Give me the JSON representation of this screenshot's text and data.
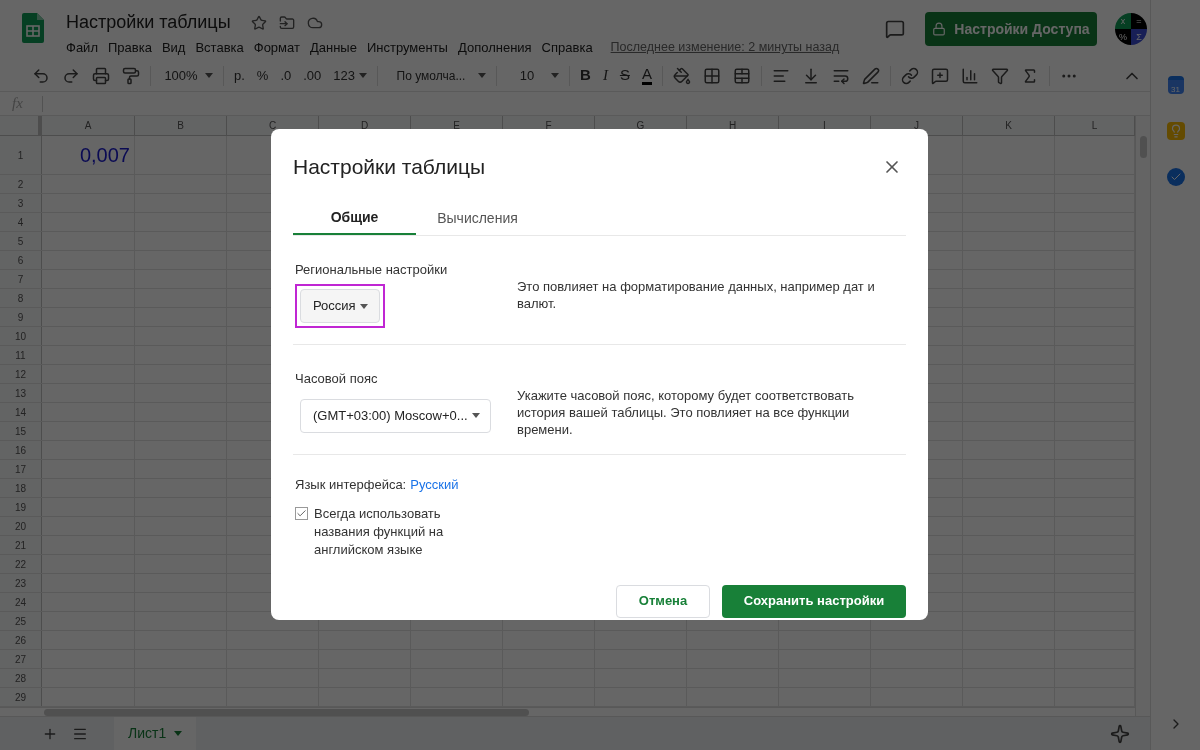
{
  "document": {
    "title": "Настройки таблицы",
    "last_edit": "Последнее изменение: 2 минуты назад"
  },
  "menu": [
    "Файл",
    "Правка",
    "Вид",
    "Вставка",
    "Формат",
    "Данные",
    "Инструменты",
    "Дополнения",
    "Справка"
  ],
  "share_button": "Настройки Доступа",
  "avatar": [
    "x",
    "=",
    "%",
    "Σ"
  ],
  "toolbar": {
    "zoom": "100%",
    "currency": "р.",
    "percent": "%",
    "decrease_decimals": ".0",
    "increase_decimals": ".00",
    "number_format": "123",
    "font": "По умолча...",
    "font_size": "10",
    "bold": "B",
    "italic": "I",
    "strikethrough": "S",
    "text_color": "A"
  },
  "formula_bar": {
    "label": "fx"
  },
  "sheet": {
    "columns": [
      "A",
      "B",
      "C",
      "D",
      "E",
      "F",
      "G",
      "H",
      "I",
      "J",
      "K",
      "L"
    ],
    "rows": [
      "1",
      "2",
      "3",
      "4",
      "5",
      "6",
      "7",
      "8",
      "9",
      "10",
      "11",
      "12",
      "13",
      "14",
      "15",
      "16",
      "17",
      "18",
      "19",
      "20",
      "21",
      "22",
      "23",
      "24",
      "25",
      "26",
      "27",
      "28",
      "29"
    ],
    "cells": [
      {
        "value": "0,007"
      }
    ]
  },
  "side_panel": {
    "calendar_day": "31"
  },
  "sheet_tabs": [
    {
      "label": "Лист1",
      "selected": true
    }
  ],
  "dialog": {
    "title": "Настройки таблицы",
    "tabs": [
      {
        "label": "Общие",
        "selected": true
      },
      {
        "label": "Вычисления",
        "selected": false
      }
    ],
    "sections": [
      {
        "kind": "select",
        "label": "Региональные настройки",
        "value": "Россия",
        "highlighted": true,
        "description": "Это повлияет на форматирование данных, например дат и валют."
      },
      {
        "kind": "select",
        "label": "Часовой пояс",
        "value": "(GMT+03:00) Moscow+0...",
        "highlighted": false,
        "description": "Укажите часовой пояс, которому будет соответствовать история вашей таблицы. Это повлияет на все функции времени."
      }
    ],
    "language": {
      "label": "Язык интерфейса:",
      "value": "Русский"
    },
    "english_functions": {
      "label": "Всегда использовать названия функций на английском языке",
      "checked": true
    },
    "buttons": {
      "cancel": "Отмена",
      "save": "Сохранить настройки"
    }
  }
}
